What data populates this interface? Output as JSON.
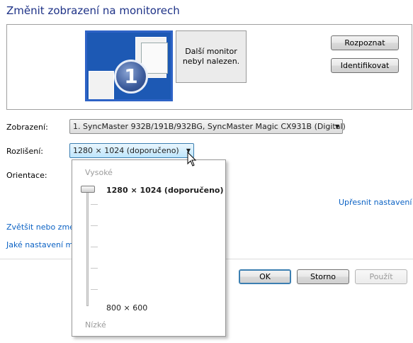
{
  "title": "Změnit zobrazení na monitorech",
  "preview": {
    "monitor1_number": "1",
    "monitor2_text_line1": "Další monitor",
    "monitor2_text_line2": "nebyl nalezen."
  },
  "buttons": {
    "detect": "Rozpoznat",
    "identify": "Identifikovat",
    "ok": "OK",
    "cancel": "Storno",
    "apply": "Použít"
  },
  "fields": {
    "display_label": "Zobrazení:",
    "display_value": "1. SyncMaster 932B/191B/932BG, SyncMaster Magic CX931B (Digital)",
    "resolution_label": "Rozlišení:",
    "resolution_value": "1280 × 1024 (doporučeno)",
    "orientation_label": "Orientace:"
  },
  "links": {
    "advanced": "Upřesnit nastavení",
    "enlarge_partial": "Zvětšit nebo zme",
    "which_settings_partial": "Jaké nastavení m"
  },
  "popup": {
    "high_label": "Vysoké",
    "low_label": "Nízké",
    "current_label": "1280 × 1024 (doporučeno)",
    "min_label": "800 × 600",
    "slider_position": 1.0
  },
  "colors": {
    "title": "#1e3287",
    "link": "#0b62c4",
    "monitor_active": "#1d59b4"
  }
}
